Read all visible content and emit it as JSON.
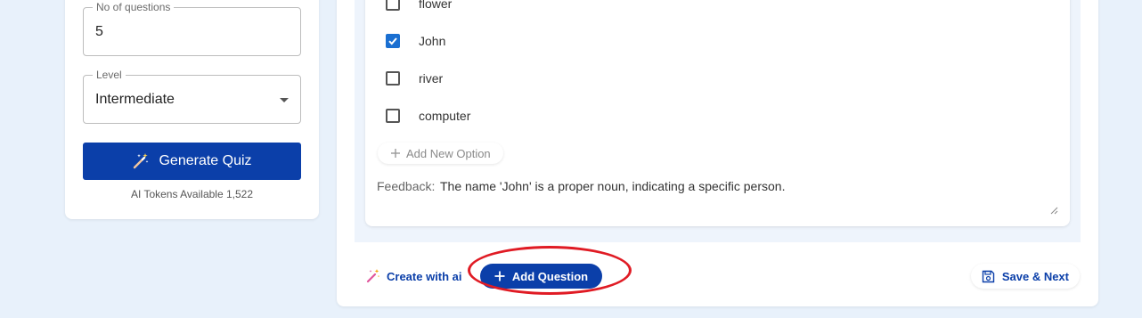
{
  "settings": {
    "questions_label": "No of questions",
    "questions_value": "5",
    "level_label": "Level",
    "level_value": "Intermediate",
    "generate_label": "Generate Quiz",
    "tokens_text": "AI Tokens Available 1,522"
  },
  "question": {
    "options": [
      {
        "label": "flower",
        "checked": false
      },
      {
        "label": "John",
        "checked": true
      },
      {
        "label": "river",
        "checked": false
      },
      {
        "label": "computer",
        "checked": false
      }
    ],
    "add_option_label": "Add New Option",
    "feedback_label": "Feedback:",
    "feedback_text": "The name 'John' is a proper noun, indicating a specific person."
  },
  "actions": {
    "create_ai_label": "Create with ai",
    "add_question_label": "Add Question",
    "save_next_label": "Save & Next"
  },
  "colors": {
    "primary": "#0b3fa9",
    "checkbox_checked": "#1a6fd1",
    "annotation": "#e01b24"
  }
}
